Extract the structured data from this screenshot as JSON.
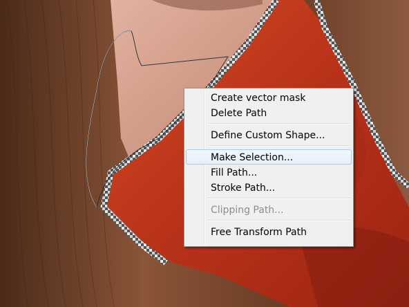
{
  "menu": {
    "items": [
      {
        "label": "Create vector mask"
      },
      {
        "label": "Delete Path"
      },
      {
        "label": "Define Custom Shape..."
      },
      {
        "label": "Make Selection..."
      },
      {
        "label": "Fill Path..."
      },
      {
        "label": "Stroke Path..."
      },
      {
        "label": "Clipping Path..."
      },
      {
        "label": "Free Transform Path"
      }
    ],
    "highlighted": "Make Selection...",
    "disabled": [
      "Clipping Path..."
    ]
  },
  "colors": {
    "hair": "#6e3f26",
    "skin": "#c9907a",
    "red_paint": "#c8381a",
    "menu_bg": "#f0f0f0",
    "highlight": "#e5eefa"
  }
}
